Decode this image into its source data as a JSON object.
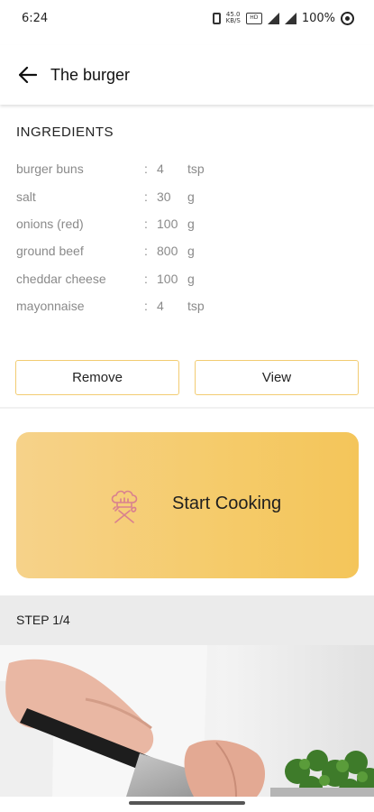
{
  "status_bar": {
    "time": "6:24",
    "net_speed_top": "45.0",
    "net_speed_bottom": "KB/S",
    "hd_badge": "HD",
    "battery": "100%"
  },
  "app_bar": {
    "title": "The burger"
  },
  "ingredients": {
    "heading": "INGREDIENTS",
    "separator": ":",
    "items": [
      {
        "name": "burger buns",
        "qty": "4",
        "unit": "tsp"
      },
      {
        "name": "salt",
        "qty": "30",
        "unit": "g"
      },
      {
        "name": "onions (red)",
        "qty": "100",
        "unit": "g"
      },
      {
        "name": "ground beef",
        "qty": "800",
        "unit": "g"
      },
      {
        "name": "cheddar cheese",
        "qty": "100",
        "unit": "g"
      },
      {
        "name": "mayonnaise",
        "qty": "4",
        "unit": "tsp"
      }
    ]
  },
  "actions": {
    "remove_label": "Remove",
    "view_label": "View"
  },
  "cook_card": {
    "label": "Start Cooking",
    "icon": "chef-hat-utensils-icon"
  },
  "step": {
    "label": "STEP 1/4"
  },
  "colors": {
    "accent": "#f5cb6a",
    "button_border": "#f2cc72",
    "icon_stroke": "#d9808f"
  }
}
